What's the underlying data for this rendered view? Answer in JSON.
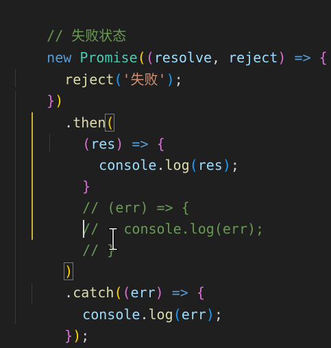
{
  "editor": {
    "lines": [
      {
        "tokens": [
          "// 失败状态"
        ]
      },
      {
        "tokens": [
          "new",
          " ",
          "Promise",
          "(",
          "(",
          "resolve",
          ", ",
          "reject",
          ")",
          " => ",
          "{"
        ]
      },
      {
        "tokens": [
          "reject",
          "(",
          "'失败'",
          ")",
          ";"
        ]
      },
      {
        "tokens": [
          "}",
          ")"
        ]
      },
      {
        "tokens": [
          ".",
          "then",
          "("
        ]
      },
      {
        "tokens": [
          "(",
          "res",
          ")",
          " => ",
          "{"
        ]
      },
      {
        "tokens": [
          "console",
          ".",
          "log",
          "(",
          "res",
          ")",
          ";"
        ]
      },
      {
        "tokens": [
          "}"
        ]
      },
      {
        "tokens": [
          "// (err) => {"
        ]
      },
      {
        "tokens": [
          "//   console.log(err);"
        ]
      },
      {
        "tokens": [
          "// }"
        ]
      },
      {
        "tokens": [
          ")"
        ]
      },
      {
        "tokens": [
          ".",
          "catch",
          "(",
          "(",
          "err",
          ")",
          " => ",
          "{"
        ]
      },
      {
        "tokens": [
          "console",
          ".",
          "log",
          "(",
          "err",
          ")",
          ";"
        ]
      },
      {
        "tokens": [
          "}",
          ")",
          ";"
        ]
      }
    ]
  },
  "colors": {
    "background": "#1f1f1f",
    "comment": "#6a9955",
    "keyword": "#569cd6",
    "class": "#4ec9b0",
    "parameter": "#9cdcfe",
    "function": "#dcdcaa",
    "string": "#ce9178",
    "bracket_level1": "#ffd700",
    "bracket_level2": "#da70d6",
    "bracket_level3": "#179fff",
    "active_indent_guide": "#c9b33a"
  },
  "pointer_icon": "i-beam-cursor-icon"
}
